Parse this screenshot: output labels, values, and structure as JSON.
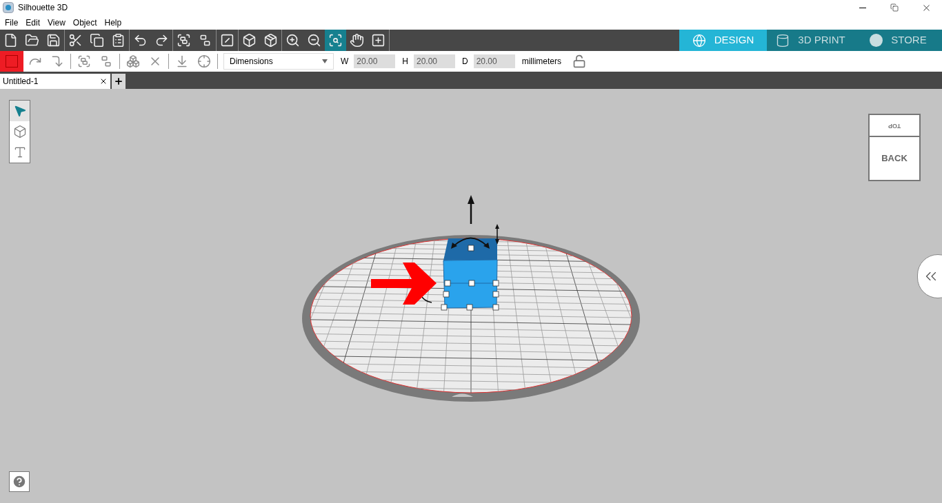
{
  "window": {
    "title": "Silhouette 3D"
  },
  "menu": [
    "File",
    "Edit",
    "View",
    "Object",
    "Help"
  ],
  "toolbar": [
    [
      {
        "kind": "new",
        "selected": false
      },
      {
        "kind": "open",
        "selected": false
      },
      {
        "kind": "save",
        "selected": false
      }
    ],
    [
      {
        "kind": "cut",
        "selected": false
      },
      {
        "kind": "copy",
        "selected": false
      },
      {
        "kind": "paste",
        "selected": false
      }
    ],
    [
      {
        "kind": "undo",
        "selected": false
      },
      {
        "kind": "redo",
        "selected": false
      }
    ],
    [
      {
        "kind": "group",
        "selected": false
      },
      {
        "kind": "ungroup",
        "selected": false
      }
    ],
    [
      {
        "kind": "slice",
        "selected": false
      }
    ],
    [
      {
        "kind": "cube",
        "selected": false
      },
      {
        "kind": "cube-bottom",
        "selected": false
      }
    ],
    [
      {
        "kind": "zoom-in",
        "selected": false
      },
      {
        "kind": "zoom-out",
        "selected": false
      },
      {
        "kind": "zoom-fit",
        "selected": true
      },
      {
        "kind": "pan",
        "selected": false
      },
      {
        "kind": "fit",
        "selected": false
      }
    ]
  ],
  "modes": [
    {
      "kind": "design",
      "label": "DESIGN",
      "selected": true
    },
    {
      "kind": "print",
      "label": "3D PRINT",
      "selected": false
    },
    {
      "kind": "store",
      "label": "STORE",
      "selected": false
    }
  ],
  "object_bar": {
    "color": "#ee1c24",
    "dropdown": "Dimensions",
    "fields": [
      {
        "label": "W",
        "value": "20.00"
      },
      {
        "label": "H",
        "value": "20.00"
      },
      {
        "label": "D",
        "value": "20.00"
      }
    ],
    "unit": "millimeters",
    "locked": false
  },
  "documents": [
    {
      "title": "Untitled-1",
      "selected": true
    }
  ],
  "tools": [
    {
      "kind": "select",
      "selected": true
    },
    {
      "kind": "shape",
      "selected": false
    },
    {
      "kind": "text",
      "selected": false
    }
  ],
  "view_cube": {
    "top": "TOP",
    "front": "BACK"
  }
}
